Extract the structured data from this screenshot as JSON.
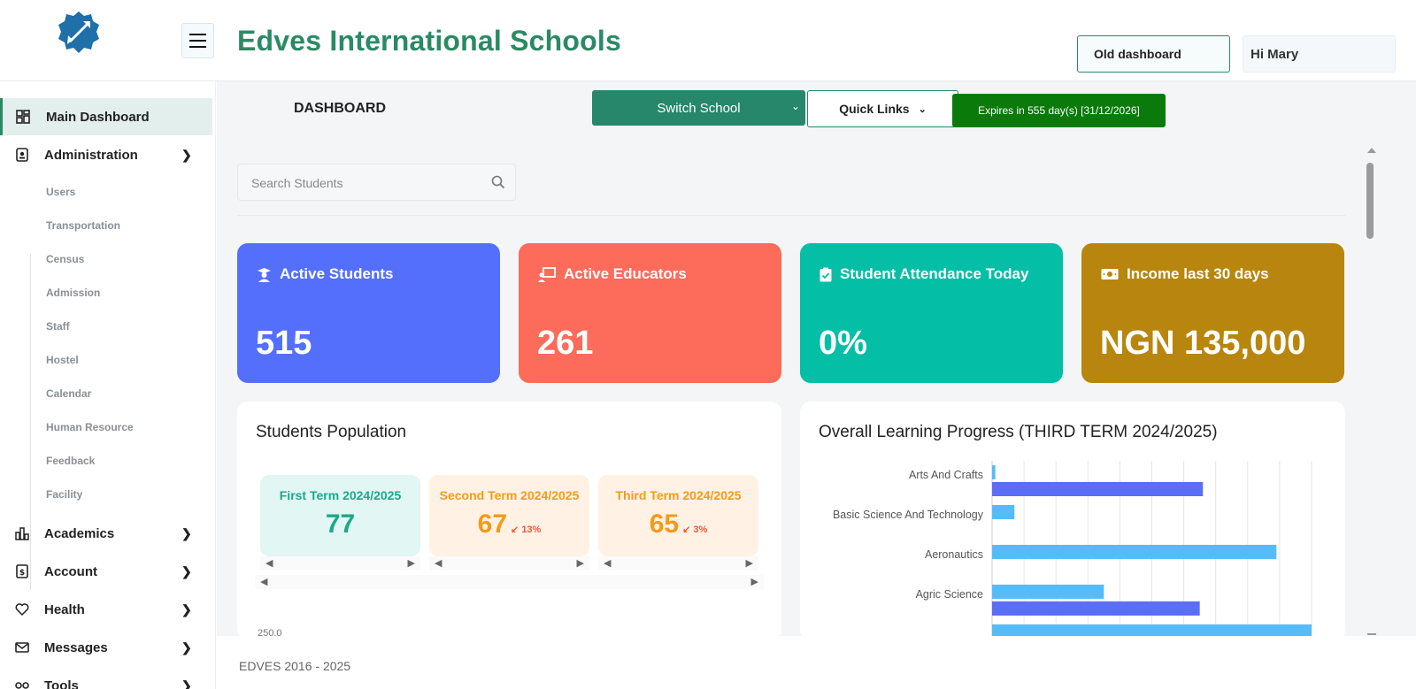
{
  "header": {
    "title": "Edves International Schools",
    "old_dashboard": "Old dashboard",
    "greeting": "Hi Mary"
  },
  "sidebar": {
    "main_dashboard": "Main Dashboard",
    "administration": "Administration",
    "admin_items": [
      "Users",
      "Transportation",
      "Census",
      "Admission",
      "Staff",
      "Hostel",
      "Calendar",
      "Human Resource",
      "Feedback",
      "Facility"
    ],
    "academics": "Academics",
    "account": "Account",
    "health": "Health",
    "messages": "Messages",
    "tools": "Tools"
  },
  "toolbar": {
    "page_title": "DASHBOARD",
    "switch_school": "Switch School",
    "quick_links": "Quick Links",
    "expires": "Expires in 555 day(s) [31/12/2026]"
  },
  "search": {
    "placeholder": "Search Students"
  },
  "stats": [
    {
      "label": "Active Students",
      "value": "515",
      "color": "#546ffc",
      "icon": "student-icon"
    },
    {
      "label": "Active Educators",
      "value": "261",
      "color": "#fd6b5a",
      "icon": "educator-icon"
    },
    {
      "label": "Student Attendance Today",
      "value": "0%",
      "color": "#04bea6",
      "icon": "clipboard-check-icon"
    },
    {
      "label": "Income last 30 days",
      "value": "NGN 135,000",
      "color": "#b8860e",
      "icon": "money-icon"
    }
  ],
  "population": {
    "title": "Students Population",
    "terms": [
      {
        "name": "First Term 2024/2025",
        "value": "77",
        "delta": "",
        "color": "#1aa98a",
        "bg": "#e2f6f3"
      },
      {
        "name": "Second Term 2024/2025",
        "value": "67",
        "delta": "13%",
        "color": "#f59a18",
        "bg": "#fff2e4"
      },
      {
        "name": "Third Term 2024/2025",
        "value": "65",
        "delta": "3%",
        "color": "#f59a18",
        "bg": "#fff2e4"
      }
    ],
    "clipped_axis_label": "250.0"
  },
  "chart_data": {
    "type": "bar",
    "orientation": "horizontal",
    "title": "Overall Learning Progress (THIRD TERM 2024/2025)",
    "categories": [
      "Arts And Crafts",
      "Basic Science And Technology",
      "Aeronautics",
      "Agric Science"
    ],
    "series": [
      {
        "values": [
          1,
          7,
          89,
          35
        ],
        "color": "#56bcf9"
      },
      {
        "values": [
          66,
          null,
          null,
          65
        ],
        "color": "#5a6ff5"
      }
    ],
    "xlim": [
      0,
      100
    ],
    "grid": true,
    "partial_bar_next_category": 100
  },
  "footer": {
    "text": "EDVES 2016 - 2025"
  }
}
